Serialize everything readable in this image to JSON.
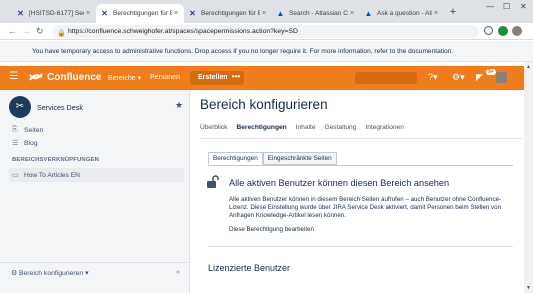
{
  "browser": {
    "tabs": [
      {
        "title": "[HSITSD-6177] Securi",
        "icon": "jira-icon",
        "active": false
      },
      {
        "title": "Berechtigungen für B",
        "icon": "confluence-settings-icon",
        "active": true
      },
      {
        "title": "Berechtigungen für B",
        "icon": "confluence-settings-icon",
        "active": false
      },
      {
        "title": "Search - Atlassian Co",
        "icon": "atlassian-icon",
        "active": false
      },
      {
        "title": "Ask a question - Atla",
        "icon": "atlassian-icon",
        "active": false
      }
    ],
    "url": "https://confluence.schweighofer.at/spaces/spacepermissions.action?key=SD"
  },
  "banner": {
    "text": "You have temporary access to administrative functions. Drop access if you no longer require it. For more information, refer to the documentation."
  },
  "header": {
    "logo": "Confluence",
    "nav": [
      "Bereiche ▾",
      "Personen"
    ],
    "create": "Erstellen",
    "more": "•••",
    "notifications_badge": "9+"
  },
  "sidebar": {
    "space_name": "Services Desk",
    "items": [
      {
        "label": "Seiten",
        "icon": "pages-icon"
      },
      {
        "label": "Blog",
        "icon": "rss-icon"
      }
    ],
    "section_title": "BEREICHSVERKNÜPFUNGEN",
    "shortcuts": [
      {
        "label": "How To Articles EN",
        "icon": "page-icon"
      }
    ],
    "footer_label": "Bereich konfigurieren ▾",
    "collapse": "«"
  },
  "main": {
    "title": "Bereich konfigurieren",
    "subnav": [
      "Überblick",
      "Berechtigungen",
      "Inhalte",
      "Gestaltung",
      "Integrationen"
    ],
    "subnav_selected": "Berechtigungen",
    "permission_tabs": [
      "Berechtigungen",
      "Eingeschränkte Seiten"
    ],
    "permission_title": "Alle aktiven Benutzer können diesen Bereich ansehen",
    "permission_desc": "Alle aktiven Benutzer können in diesem Bereich Seiten aufrufen – auch Benutzer ohne Confluence-Lizenz. Diese Einstellung wurde über JIRA Service Desk aktiviert, damit Personen beim Stellen von Anfragen Knowledge-Artikel lesen können.",
    "edit_link": "Diese Berechtigung bearbeiten",
    "section2_title": "Lizenzierte Benutzer"
  },
  "colors": {
    "confluence_orange": "#f07c1b",
    "tab_strip": "#dee1e6"
  }
}
